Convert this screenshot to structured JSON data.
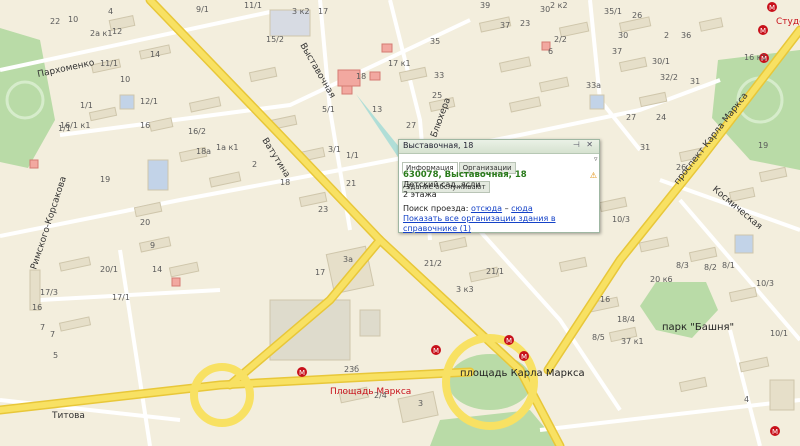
{
  "map": {
    "colors": {
      "background": "#f3eedd",
      "building": "#e6dfc9",
      "building_outline": "#cfc6ab",
      "major_road": "#f6dc4c",
      "minor_road": "#ffffff",
      "park": "#b9dba7",
      "highlight": "#f2a8a0",
      "metro": "#c8111b"
    },
    "streets": [
      "Выставочная",
      "Ватутина",
      "Блюхера",
      "Римского-Корсакова",
      "Титова",
      "Пархоменко",
      "проспект Карла Маркса",
      "Космическая",
      "Студен"
    ],
    "places": [
      "площадь Карла Маркса",
      "парк \"Башня\"",
      "Площадь Маркса"
    ],
    "metro_label": "Площадь Маркса",
    "house_numbers": [
      "10",
      "4",
      "9/1",
      "11/1",
      "1/1",
      "1/1",
      "15/2",
      "17",
      "18",
      "13",
      "22",
      "2а к1",
      "12",
      "14",
      "11/1",
      "10",
      "12/1",
      "16",
      "16/1 к1",
      "16/2",
      "1а к1",
      "18а",
      "2",
      "18",
      "19",
      "20",
      "9",
      "14",
      "20/1",
      "17/1",
      "17/3",
      "16",
      "7",
      "7",
      "5",
      "5/1",
      "3/1",
      "1/1",
      "23",
      "17",
      "17 к1",
      "25",
      "33",
      "35",
      "37",
      "39",
      "30",
      "23",
      "27",
      "29",
      "21",
      "19",
      "21/2",
      "21/1",
      "3а",
      "3 к3",
      "23б",
      "2/4",
      "3",
      "3 к2",
      "26",
      "30",
      "2",
      "36",
      "35/1",
      "37",
      "30/1",
      "32/2",
      "31",
      "33а",
      "27",
      "31",
      "24",
      "26",
      "19",
      "16 к1",
      "16",
      "20 к6",
      "37 к1",
      "18/4",
      "8/5",
      "8/3",
      "8/2",
      "8/1",
      "10/3",
      "10/1",
      "4",
      "2/2",
      "6",
      "5",
      "10/3",
      "2 к2",
      "2 к1",
      "21",
      "23",
      "1"
    ]
  },
  "popup": {
    "title": "Выставочная, 18",
    "controls": "⊣ ✕",
    "tabs": [
      "Информация",
      "Организации",
      "Здание обслуживают"
    ],
    "more": "▿",
    "address": "630078, Выставочная, 18",
    "line1": "Детский сад, ясли",
    "line2": "2 этажа",
    "route_label": "Поиск проезда:",
    "route_from": "отсюда",
    "route_sep": "–",
    "route_to": "сюда",
    "show_all": "Показать все организации здания в справочнике (1)",
    "warn_icon": "warning-icon"
  }
}
